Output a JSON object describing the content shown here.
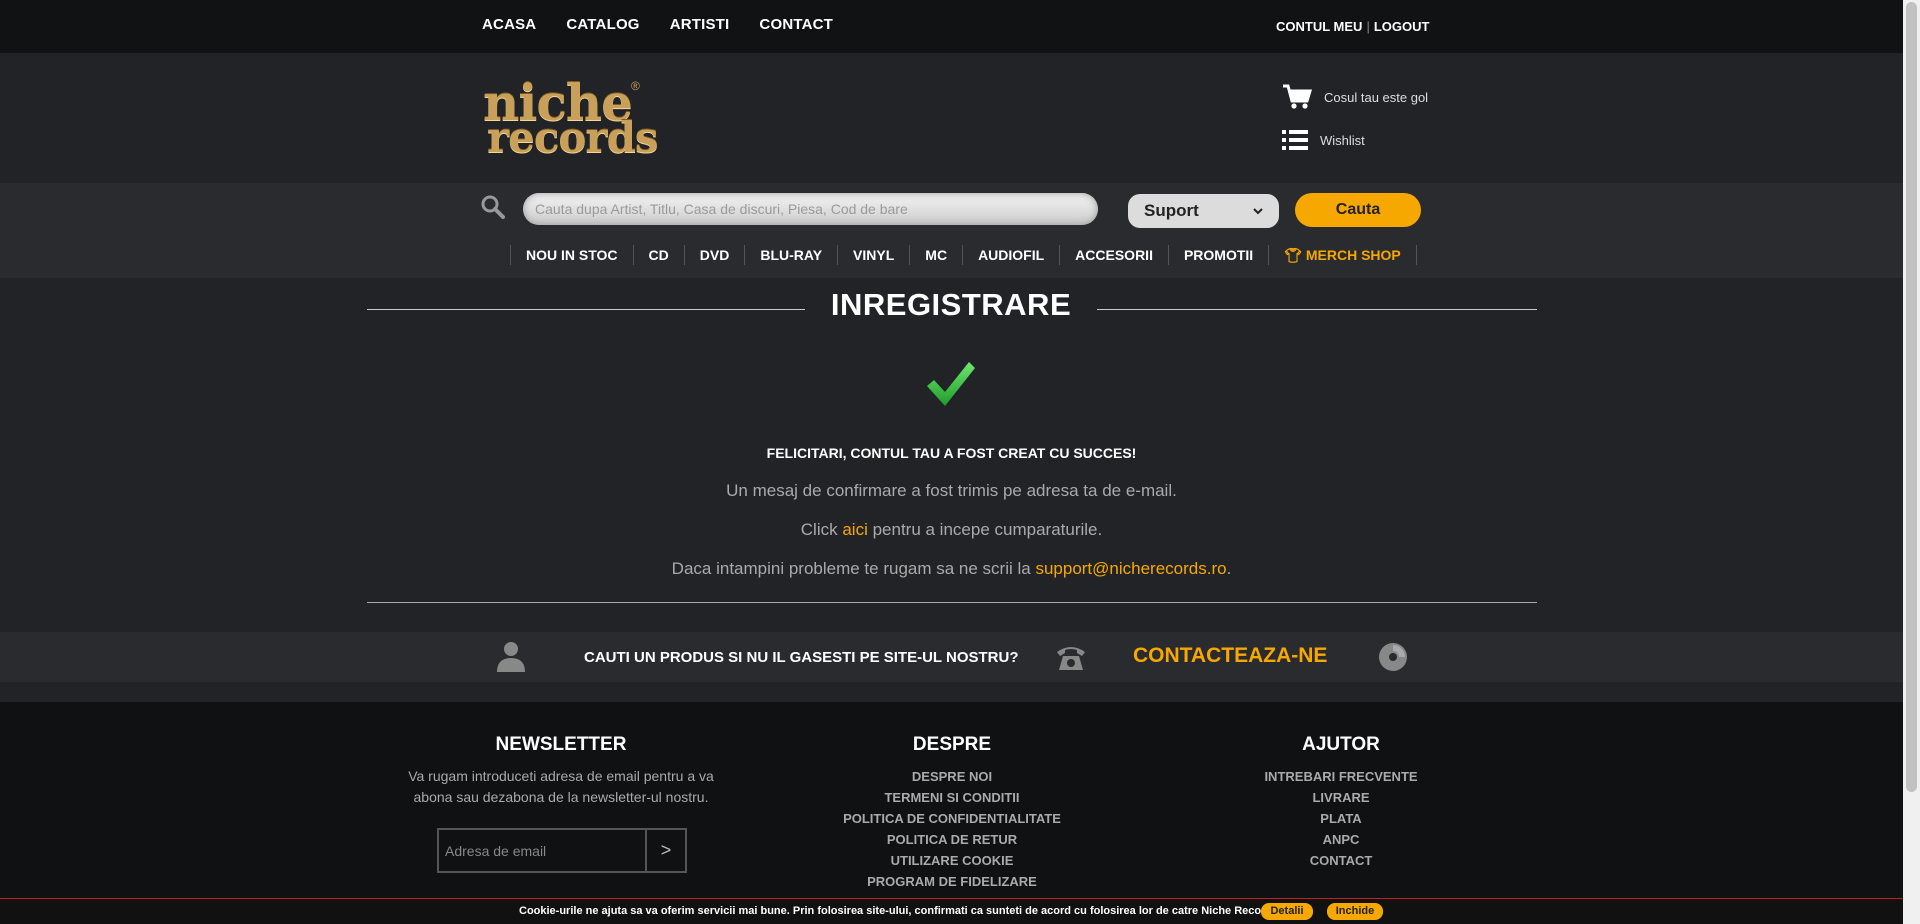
{
  "topnav": {
    "items": [
      "ACASA",
      "CATALOG",
      "ARTISTI",
      "CONTACT"
    ]
  },
  "account": {
    "my_account": "CONTUL MEU",
    "separator": "|",
    "logout": "LOGOUT"
  },
  "logo": {
    "line1": "niche",
    "line2": "records",
    "mark": "®"
  },
  "cart": {
    "label": "Cosul tau este gol",
    "icon": "cart-icon"
  },
  "wishlist": {
    "label": "Wishlist",
    "icon": "list-icon"
  },
  "search": {
    "placeholder": "Cauta dupa Artist, Titlu, Casa de discuri, Piesa, Cod de bare",
    "support_label": "Suport",
    "button": "Cauta"
  },
  "categories": [
    "NOU IN STOC",
    "CD",
    "DVD",
    "BLU-RAY",
    "VINYL",
    "MC",
    "AUDIOFIL",
    "ACCESORII",
    "PROMOTII",
    "MERCH SHOP"
  ],
  "page": {
    "title": "INREGISTRARE",
    "success": "FELICITARI, CONTUL TAU A FOST CREAT CU SUCCES!",
    "confirm": "Un mesaj de confirmare a fost trimis pe adresa ta de e-mail.",
    "click_pre": "Click ",
    "click_link": "aici",
    "click_post": " pentru a incepe cumparaturile.",
    "problem_pre": "Daca intampini probleme te rugam sa ne scrii la ",
    "problem_link": "support@nicherecords.ro",
    "problem_post": "."
  },
  "contactbar": {
    "question": "CAUTI UN PRODUS SI NU IL GASESTI PE SITE-UL NOSTRU?",
    "cta": "CONTACTEAZA-NE"
  },
  "footer": {
    "newsletter": {
      "title": "NEWSLETTER",
      "text": "Va rugam introduceti adresa de email pentru a va abona sau dezabona de la newsletter-ul nostru.",
      "placeholder": "Adresa de email",
      "submit": ">"
    },
    "despre": {
      "title": "DESPRE",
      "links": [
        "DESPRE NOI",
        "TERMENI SI CONDITII",
        "POLITICA DE CONFIDENTIALITATE",
        "POLITICA DE RETUR",
        "UTILIZARE COOKIE",
        "PROGRAM DE FIDELIZARE"
      ]
    },
    "ajutor": {
      "title": "AJUTOR",
      "links": [
        "INTREBARI FRECVENTE",
        "LIVRARE",
        "PLATA",
        "ANPC",
        "CONTACT"
      ]
    }
  },
  "cookie": {
    "text": "Cookie-urile ne ajuta sa va oferim servicii mai bune. Prin folosirea site-ului, confirmati ca sunteti de acord cu folosirea lor de catre Niche Records.",
    "details": "Detalii",
    "close": "Inchide"
  },
  "colors": {
    "accent": "#f7a800",
    "topbar": "#111213",
    "background": "#222326"
  }
}
